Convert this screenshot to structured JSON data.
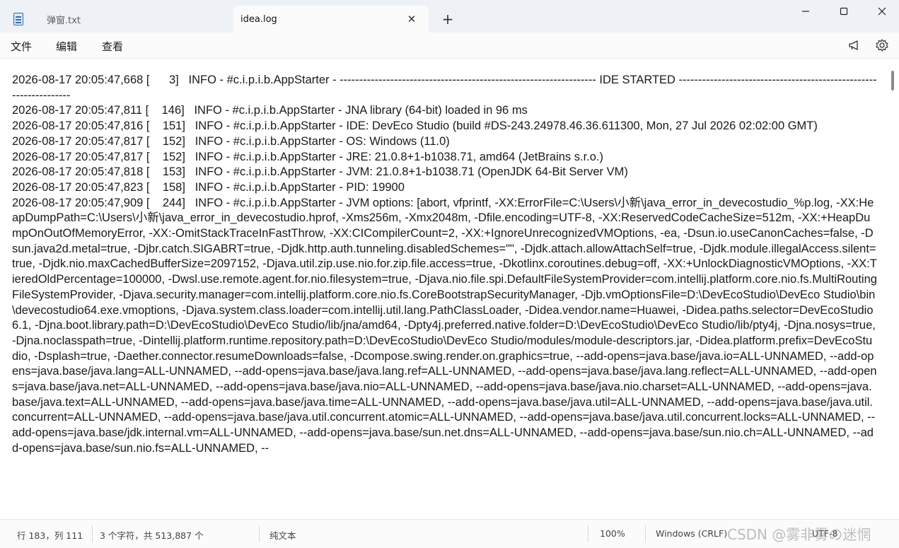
{
  "tabs": [
    {
      "label": "弹窗.txt",
      "active": false
    },
    {
      "label": "idea.log",
      "active": true
    }
  ],
  "tab_close_glyph": "✕",
  "new_tab_glyph": "+",
  "menu": {
    "file": "文件",
    "edit": "编辑",
    "view": "查看"
  },
  "icons": [
    "document-icon",
    "close-icon",
    "plus-icon",
    "minimize-icon",
    "maximize-icon",
    "window-close-icon",
    "megaphone-icon",
    "gear-icon"
  ],
  "log_lines": [
    "2026-08-17 20:05:47,668 [      3]   INFO - #c.i.p.i.b.AppStarter - ------------------------------------------------------------------ IDE STARTED ------------------------------------------------------------------",
    "2026-08-17 20:05:47,811 [    146]   INFO - #c.i.p.i.b.AppStarter - JNA library (64-bit) loaded in 96 ms",
    "2026-08-17 20:05:47,816 [    151]   INFO - #c.i.p.i.b.AppStarter - IDE: DevEco Studio (build #DS-243.24978.46.36.611300, Mon, 27 Jul 2026 02:02:00 GMT)",
    "2026-08-17 20:05:47,817 [    152]   INFO - #c.i.p.i.b.AppStarter - OS: Windows (11.0)",
    "2026-08-17 20:05:47,817 [    152]   INFO - #c.i.p.i.b.AppStarter - JRE: 21.0.8+1-b1038.71, amd64 (JetBrains s.r.o.)",
    "2026-08-17 20:05:47,818 [    153]   INFO - #c.i.p.i.b.AppStarter - JVM: 21.0.8+1-b1038.71 (OpenJDK 64-Bit Server VM)",
    "2026-08-17 20:05:47,823 [    158]   INFO - #c.i.p.i.b.AppStarter - PID: 19900",
    "2026-08-17 20:05:47,909 [    244]   INFO - #c.i.p.i.b.AppStarter - JVM options: [abort, vfprintf, -XX:ErrorFile=C:\\Users\\小新\\java_error_in_devecostudio_%p.log, -XX:HeapDumpPath=C:\\Users\\小新\\java_error_in_devecostudio.hprof, -Xms256m, -Xmx2048m, -Dfile.encoding=UTF-8, -XX:ReservedCodeCacheSize=512m, -XX:+HeapDumpOnOutOfMemoryError, -XX:-OmitStackTraceInFastThrow, -XX:CICompilerCount=2, -XX:+IgnoreUnrecognizedVMOptions, -ea, -Dsun.io.useCanonCaches=false, -Dsun.java2d.metal=true, -Djbr.catch.SIGABRT=true, -Djdk.http.auth.tunneling.disabledSchemes=\"\", -Djdk.attach.allowAttachSelf=true, -Djdk.module.illegalAccess.silent=true, -Djdk.nio.maxCachedBufferSize=2097152, -Djava.util.zip.use.nio.for.zip.file.access=true, -Dkotlinx.coroutines.debug=off, -XX:+UnlockDiagnosticVMOptions, -XX:TieredOldPercentage=100000, -Dwsl.use.remote.agent.for.nio.filesystem=true, -Djava.nio.file.spi.DefaultFileSystemProvider=com.intellij.platform.core.nio.fs.MultiRoutingFileSystemProvider, -Djava.security.manager=com.intellij.platform.core.nio.fs.CoreBootstrapSecurityManager, -Djb.vmOptionsFile=D:\\DevEcoStudio\\DevEco Studio\\bin\\devecostudio64.exe.vmoptions, -Djava.system.class.loader=com.intellij.util.lang.PathClassLoader, -Didea.vendor.name=Huawei, -Didea.paths.selector=DevEcoStudio6.1, -Djna.boot.library.path=D:\\DevEcoStudio\\DevEco Studio/lib/jna/amd64, -Dpty4j.preferred.native.folder=D:\\DevEcoStudio\\DevEco Studio/lib/pty4j, -Djna.nosys=true, -Djna.noclasspath=true, -Dintellij.platform.runtime.repository.path=D:\\DevEcoStudio\\DevEco Studio/modules/module-descriptors.jar, -Didea.platform.prefix=DevEcoStudio, -Dsplash=true, -Daether.connector.resumeDownloads=false, -Dcompose.swing.render.on.graphics=true, --add-opens=java.base/java.io=ALL-UNNAMED, --add-opens=java.base/java.lang=ALL-UNNAMED, --add-opens=java.base/java.lang.ref=ALL-UNNAMED, --add-opens=java.base/java.lang.reflect=ALL-UNNAMED, --add-opens=java.base/java.net=ALL-UNNAMED, --add-opens=java.base/java.nio=ALL-UNNAMED, --add-opens=java.base/java.nio.charset=ALL-UNNAMED, --add-opens=java.base/java.text=ALL-UNNAMED, --add-opens=java.base/java.time=ALL-UNNAMED, --add-opens=java.base/java.util=ALL-UNNAMED, --add-opens=java.base/java.util.concurrent=ALL-UNNAMED, --add-opens=java.base/java.util.concurrent.atomic=ALL-UNNAMED, --add-opens=java.base/java.util.concurrent.locks=ALL-UNNAMED, --add-opens=java.base/jdk.internal.vm=ALL-UNNAMED, --add-opens=java.base/sun.net.dns=ALL-UNNAMED, --add-opens=java.base/sun.nio.ch=ALL-UNNAMED, --add-opens=java.base/sun.nio.fs=ALL-UNNAMED, --"
  ],
  "status": {
    "position": "行 183，列 111",
    "selection": "3 个字符，共 513,887 个",
    "format": "纯文本",
    "zoom": "100%",
    "line_ending": "Windows (CRLF)",
    "encoding": "UTF-8"
  },
  "watermark": "CSDN @雾非雾の迷惘"
}
